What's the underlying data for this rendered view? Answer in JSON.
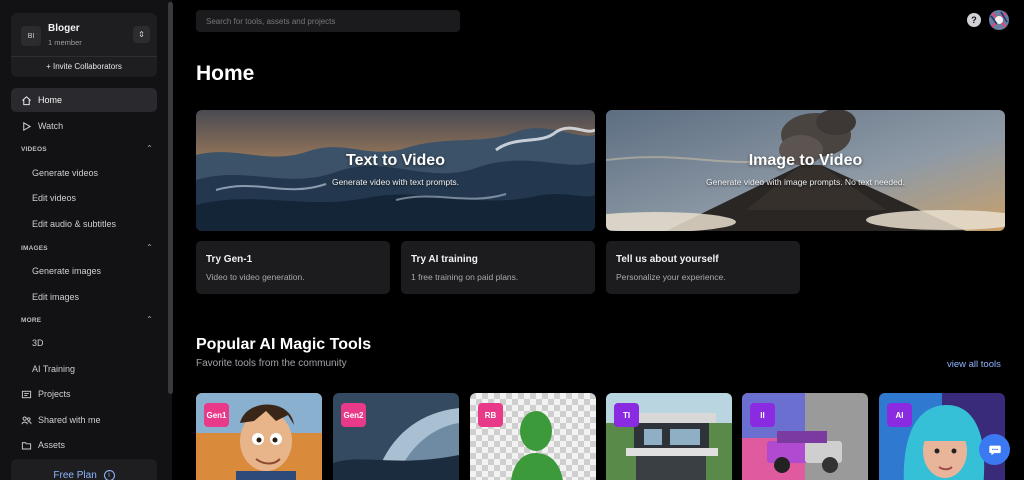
{
  "workspace": {
    "initials": "BI",
    "name": "Bloger",
    "members": "1 member",
    "invite_label": "+ Invite Collaborators"
  },
  "nav": {
    "home": "Home",
    "watch": "Watch",
    "videos_header": "VIDEOS",
    "videos_items": [
      "Generate videos",
      "Edit videos",
      "Edit audio & subtitles"
    ],
    "images_header": "IMAGES",
    "images_items": [
      "Generate images",
      "Edit images"
    ],
    "more_header": "MORE",
    "more_items": [
      "3D",
      "AI Training"
    ],
    "projects": "Projects",
    "shared": "Shared with me",
    "assets": "Assets"
  },
  "plan": {
    "label": "Free Plan",
    "info_icon": "i"
  },
  "search": {
    "placeholder": "Search for tools, assets and projects"
  },
  "header": {
    "help_icon": "?"
  },
  "page": {
    "title": "Home"
  },
  "hero_cards": [
    {
      "title": "Text to Video",
      "subtitle": "Generate video with text prompts."
    },
    {
      "title": "Image to Video",
      "subtitle": "Generate video with image prompts. No text needed."
    }
  ],
  "mini_cards": [
    {
      "title": "Try Gen-1",
      "subtitle": "Video to video generation."
    },
    {
      "title": "Try AI training",
      "subtitle": "1 free training on paid plans."
    },
    {
      "title": "Tell us about yourself",
      "subtitle": "Personalize your experience."
    }
  ],
  "popular": {
    "title": "Popular AI Magic Tools",
    "subtitle": "Favorite tools from the community",
    "view_all": "view all tools",
    "tools": [
      {
        "badge": "Gen1",
        "color": "#e93a8a"
      },
      {
        "badge": "Gen2",
        "color": "#e93a8a"
      },
      {
        "badge": "RB",
        "color": "#e93a8a"
      },
      {
        "badge": "TI",
        "color": "#8a2be2"
      },
      {
        "badge": "II",
        "color": "#8a2be2"
      },
      {
        "badge": "AI",
        "color": "#8a2be2"
      }
    ]
  },
  "colors": {
    "accent": "#3b79f2",
    "link": "#8fb6ff",
    "pink_badge": "#e93a8a",
    "purple_badge": "#8a2be2"
  }
}
